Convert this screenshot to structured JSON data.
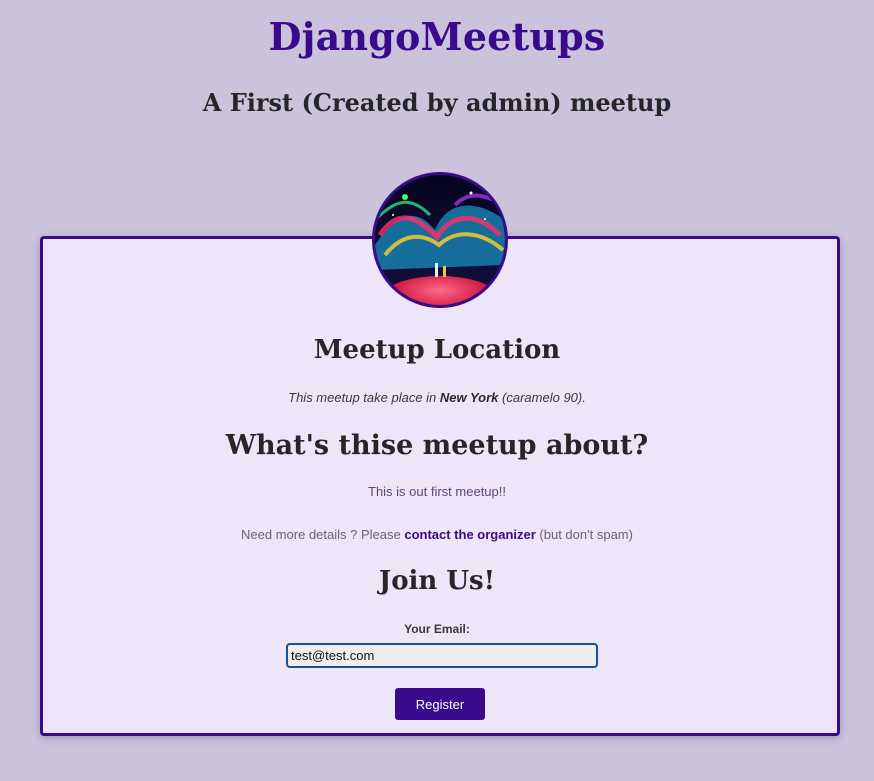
{
  "site": {
    "title": "DjangoMeetups"
  },
  "meetup": {
    "title": "A First (Created by admin) meetup",
    "location_heading": "Meetup Location",
    "location_prefix": "This meetup take place in ",
    "location_city": "New York",
    "location_suffix": " (caramelo 90).",
    "about_heading": "What's thise meetup about?",
    "description": "This is out first meetup!!",
    "details_prefix": "Need more details ? Please ",
    "details_link": "contact the organizer",
    "details_suffix": " (but don't spam)"
  },
  "join": {
    "heading": "Join Us!",
    "email_label": "Your Email:",
    "email_value": "test@test.com",
    "register_label": "Register"
  },
  "colors": {
    "brand": "#3a0a8c",
    "page_background": "#cbc3dc",
    "card_background": "#eee5f9"
  },
  "icons": {
    "avatar": "meetup-image"
  }
}
